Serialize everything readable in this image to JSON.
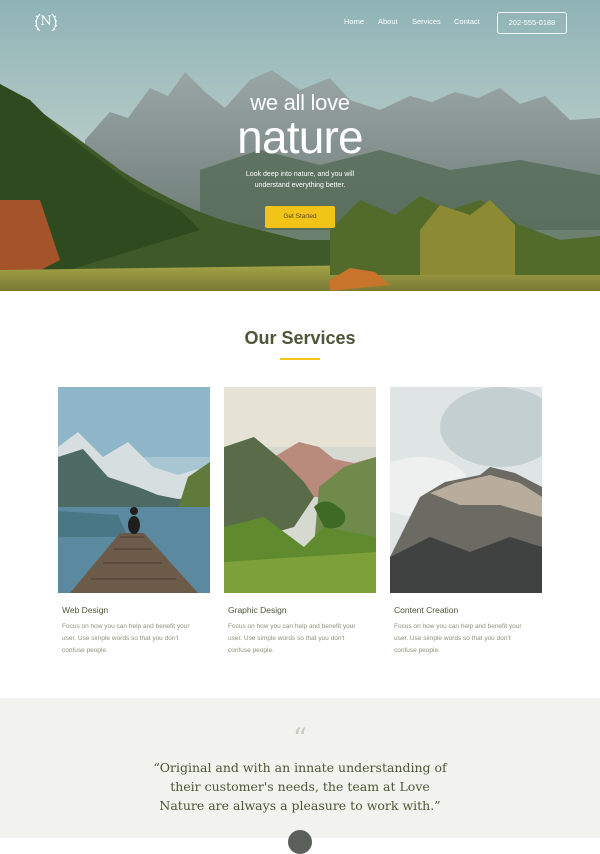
{
  "nav": {
    "logo_letter": "N",
    "links": [
      "Home",
      "About",
      "Services",
      "Contact"
    ],
    "phone": "202-555-0188"
  },
  "hero": {
    "line1": "we all love",
    "line2": "nature",
    "subtitle": "Look deep into nature, and you will understand everything better.",
    "cta": "Get Started"
  },
  "services": {
    "title": "Our Services",
    "accent_color": "#f2c418",
    "cards": [
      {
        "title": "Web Design",
        "description": "Focus on how you can help and benefit your user. Use simple words so that you don't confuse people."
      },
      {
        "title": "Graphic Design",
        "description": "Focus on how you can help and benefit your user. Use simple words so that you don't confuse people."
      },
      {
        "title": "Content Creation",
        "description": "Focus on how you can help and benefit your user. Use simple words so that you don't confuse people."
      }
    ]
  },
  "testimonial": {
    "quote_mark": "“",
    "text": "“Original and with an innate understanding of their customer's needs, the team at Love Nature are always a pleasure to work with.”"
  }
}
